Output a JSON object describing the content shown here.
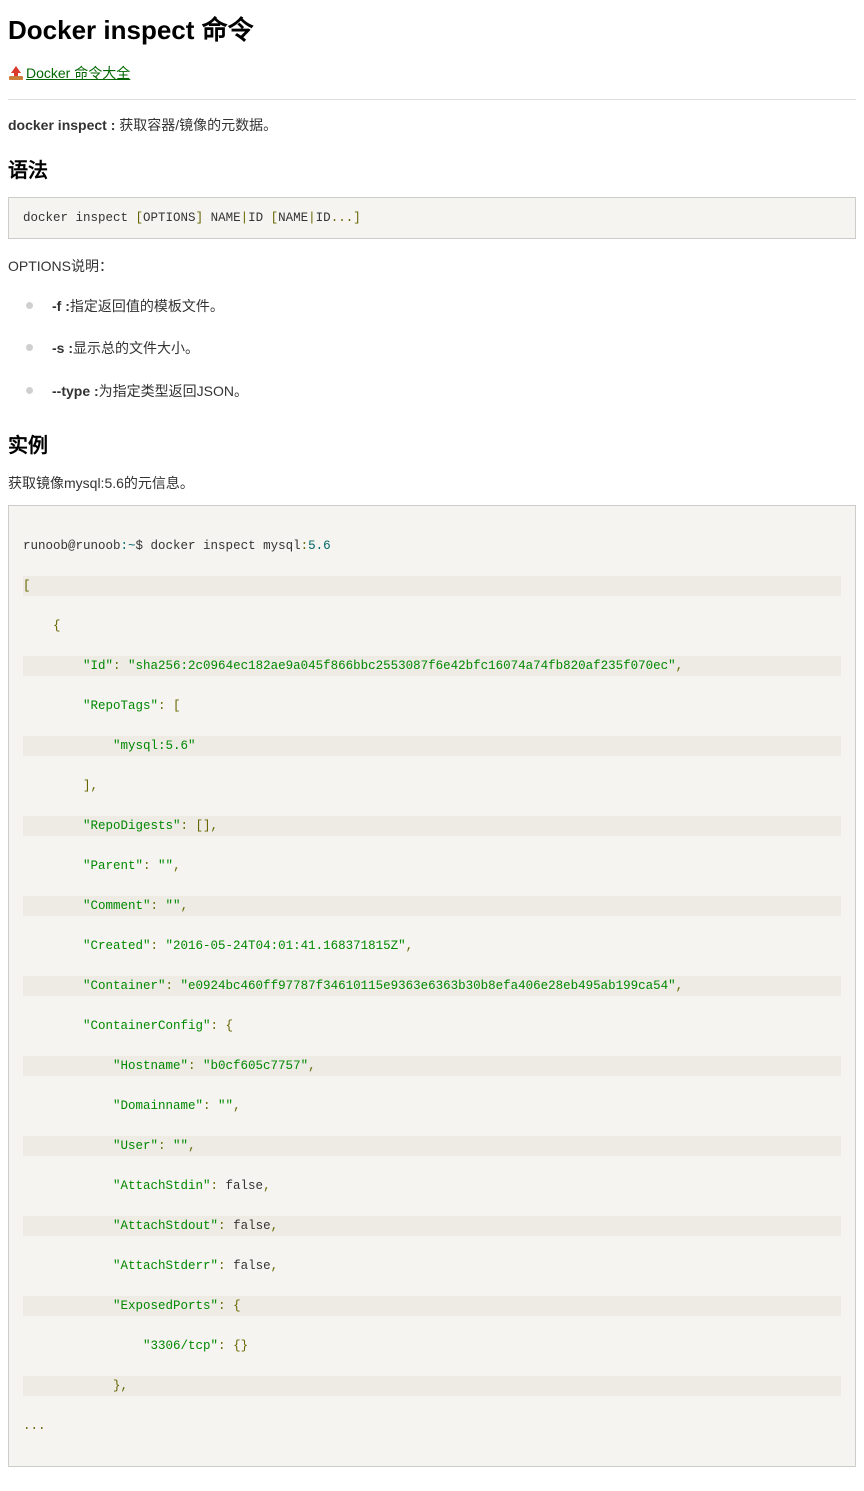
{
  "title": "Docker inspect 命令",
  "back_link": {
    "text": "Docker 命令大全"
  },
  "intro": {
    "cmd": "docker inspect :",
    "desc": " 获取容器/镜像的元数据。"
  },
  "syntax": {
    "heading": "语法",
    "code": {
      "t1": "docker inspect ",
      "t2": "[",
      "t3": "OPTIONS",
      "t4": "]",
      "t5": " NAME",
      "t6": "|",
      "t7": "ID ",
      "t8": "[",
      "t9": "NAME",
      "t10": "|",
      "t11": "ID",
      "t12": "...]"
    }
  },
  "options": {
    "label": "OPTIONS说明：",
    "items": [
      {
        "flag": "-f :",
        "desc": "指定返回值的模板文件。"
      },
      {
        "flag": "-s :",
        "desc": "显示总的文件大小。"
      },
      {
        "flag": "--type :",
        "desc": "为指定类型返回JSON。"
      }
    ]
  },
  "examples": {
    "heading": "实例",
    "desc": "获取镜像mysql:5.6的元信息。"
  },
  "chart_data": {
    "type": "table",
    "prompt": "runoob@runoob:~$ docker inspect mysql:5.6",
    "json_output": [
      {
        "Id": "sha256:2c0964ec182ae9a045f866bbc2553087f6e42bfc16074a74fb820af235f070ec",
        "RepoTags": [
          "mysql:5.6"
        ],
        "RepoDigests": [],
        "Parent": "",
        "Comment": "",
        "Created": "2016-05-24T04:01:41.168371815Z",
        "Container": "e0924bc460ff97787f34610115e9363e6363b30b8efa406e28eb495ab199ca54",
        "ContainerConfig": {
          "Hostname": "b0cf605c7757",
          "Domainname": "",
          "User": "",
          "AttachStdin": false,
          "AttachStdout": false,
          "AttachStderr": false,
          "ExposedPorts": {
            "3306/tcp": {}
          }
        }
      }
    ],
    "truncated": true
  },
  "jb": {
    "prompt_user": "runoob@runoob",
    "prompt_sep": ":~",
    "prompt_cmd": "$ docker inspect mysql",
    "prompt_ver": ":",
    "prompt_vnum": "5.6",
    "lb": "[",
    "ob": "    {",
    "id_k": "        \"Id\"",
    "colon": ":",
    "sp": " ",
    "id_v": "\"sha256:2c0964ec182ae9a045f866bbc2553087f6e42bfc16074a74fb820af235f070ec\"",
    "comma": ",",
    "rtags_k": "        \"RepoTags\"",
    "rtags_ob": " [",
    "rtags_v": "            \"mysql:5.6\"",
    "rtags_cb": "        ],",
    "rdigests_k": "        \"RepoDigests\"",
    "rdigests_v": " [],",
    "parent_k": "        \"Parent\"",
    "empty_str": " \"\"",
    "comment_k": "        \"Comment\"",
    "created_k": "        \"Created\"",
    "created_v": " \"2016-05-24T04:01:41.168371815Z\"",
    "container_k": "        \"Container\"",
    "container_v": " \"e0924bc460ff97787f34610115e9363e6363b30b8efa406e28eb495ab199ca54\"",
    "ccfg_k": "        \"ContainerConfig\"",
    "ccfg_ob": " {",
    "host_k": "            \"Hostname\"",
    "host_v": " \"b0cf605c7757\"",
    "dom_k": "            \"Domainname\"",
    "dom_v": " \"\"",
    "user_k": "            \"User\"",
    "user_v": " \"\"",
    "astdin_k": "            \"AttachStdin\"",
    "false_v": " false",
    "astdout_k": "            \"AttachStdout\"",
    "astderr_k": "            \"AttachStderr\"",
    "eports_k": "            \"ExposedPorts\"",
    "eports_ob": " {",
    "port_k": "                \"3306/tcp\"",
    "port_v": " {}",
    "eports_cb": "            },",
    "ellipsis": "..."
  }
}
